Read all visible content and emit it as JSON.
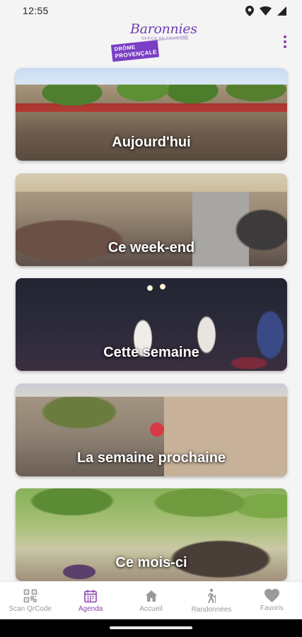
{
  "status_bar": {
    "time": "12:55",
    "icons": [
      "location-icon",
      "wifi-icon",
      "signal-icon"
    ]
  },
  "header": {
    "logo": {
      "title": "Baronnies",
      "subtitle": "OFFICE DE TOURISME",
      "badge_line1": "DRÔME",
      "badge_line2": "PROVENÇALE"
    },
    "menu_icon": "more-vertical-icon"
  },
  "agenda_cards": [
    {
      "label": "Aujourd'hui"
    },
    {
      "label": "Ce week-end"
    },
    {
      "label": "Cette semaine"
    },
    {
      "label": "La semaine prochaine"
    },
    {
      "label": "Ce mois-ci"
    }
  ],
  "bottom_nav": {
    "items": [
      {
        "label": "Scan QrCode",
        "icon": "qrcode-icon",
        "active": false
      },
      {
        "label": "Agenda",
        "icon": "calendar-icon",
        "active": true
      },
      {
        "label": "Accueil",
        "icon": "home-icon",
        "active": false
      },
      {
        "label": "Randonnées",
        "icon": "hiker-icon",
        "active": false
      },
      {
        "label": "Favoris",
        "icon": "heart-icon",
        "active": false
      }
    ],
    "active_color": "#8e3fb0",
    "inactive_color": "#9a9a9a"
  }
}
